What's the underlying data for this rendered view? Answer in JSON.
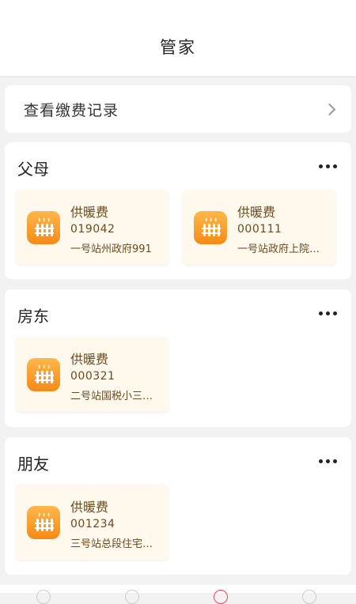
{
  "header": {
    "title": "管家"
  },
  "record": {
    "label": "查看缴费记录"
  },
  "icons": {
    "bill": "radiator-heat-icon",
    "more": "more-dots-icon",
    "chevron": "chevron-right-icon"
  },
  "colors": {
    "accent": "#f68a16",
    "card_bg": "#fff8ed",
    "text_brown": "#6b4a1e"
  },
  "groups": [
    {
      "title": "父母",
      "bills": [
        {
          "name": "供暖费",
          "number": "019042",
          "address": "一号站州政府991"
        },
        {
          "name": "供暖费",
          "number": "000111",
          "address": "一号站政府上院…"
        }
      ]
    },
    {
      "title": "房东",
      "bills": [
        {
          "name": "供暖费",
          "number": "000321",
          "address": "二号站国税小三…"
        }
      ]
    },
    {
      "title": "朋友",
      "bills": [
        {
          "name": "供暖费",
          "number": "001234",
          "address": "三号站总段住宅…"
        }
      ]
    }
  ]
}
